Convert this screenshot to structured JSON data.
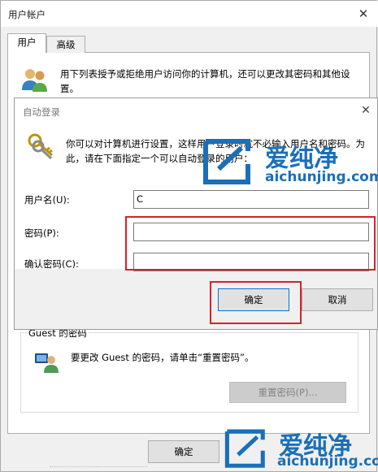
{
  "outer_window": {
    "title": "用户帐户",
    "close_glyph": "✕",
    "tabs": [
      {
        "label": "用户"
      },
      {
        "label": "高级"
      }
    ],
    "users_description": "用下列表授予或拒绝用户访问你的计算机，还可以更改其密码和其他设置。",
    "guest": {
      "group_title": "Guest 的密码",
      "description": "要更改 Guest 的密码，请单击“重置密码”。",
      "reset_button": "重置密码(P)..."
    },
    "ok_button": "确定"
  },
  "dialog": {
    "title": "自动登录",
    "close_glyph": "✕",
    "description": "你可以对计算机进行设置，这样用户登录时就不必输入用户名和密码。为此，请在下面指定一个可以自动登录的用户：",
    "username_label": "用户名(U):",
    "username_value": "C",
    "password_label": "密码(P):",
    "password_value": "",
    "confirm_label": "确认密码(C):",
    "confirm_value": "",
    "ok_button": "确定",
    "cancel_button": "取消"
  },
  "watermark": {
    "brand": "爱纯净",
    "domain": "aichunjing.com",
    "color": "#1a6fb8"
  },
  "icons": {
    "users": "users-icon",
    "keys": "keys-icon",
    "guest": "guest-user-icon"
  },
  "highlight_color": "#d9202a"
}
